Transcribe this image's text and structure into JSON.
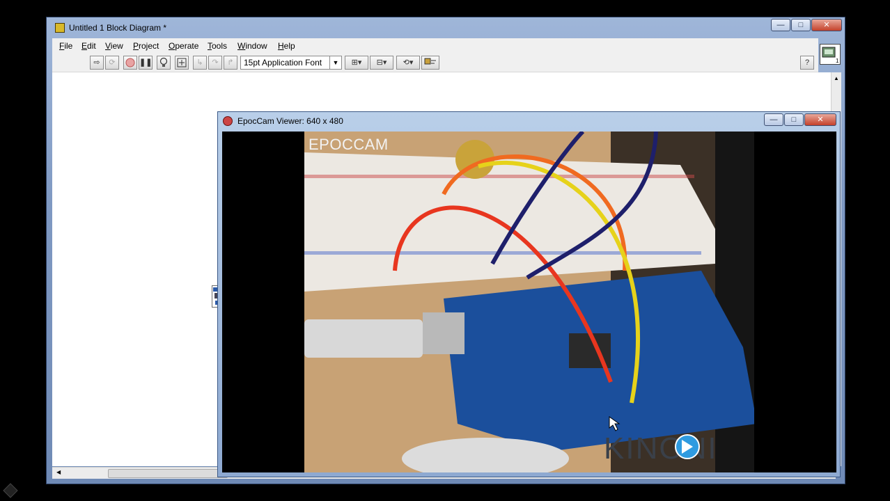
{
  "main_window": {
    "title": "Untitled 1 Block Diagram *",
    "controls": {
      "minimize": "—",
      "maximize": "□",
      "close": "✕"
    }
  },
  "menu": [
    {
      "ul": "F",
      "rest": "ile"
    },
    {
      "ul": "E",
      "rest": "dit"
    },
    {
      "ul": "V",
      "rest": "iew"
    },
    {
      "ul": "P",
      "rest": "roject"
    },
    {
      "ul": "O",
      "rest": "perate"
    },
    {
      "ul": "T",
      "rest": "ools"
    },
    {
      "ul": "W",
      "rest": "indow"
    },
    {
      "ul": "H",
      "rest": "elp"
    }
  ],
  "toolbar": {
    "font_select_value": "15pt Application Font",
    "help_label": "?"
  },
  "epoccam_window": {
    "title": "EpocCam Viewer: 640 x 480",
    "overlay_label": "EPOCCAM",
    "controls": {
      "minimize": "—",
      "maximize": "□",
      "close": "✕"
    }
  },
  "watermark": {
    "text": "KINONI"
  },
  "colors": {
    "wire_red": "#e8361f",
    "wire_orange": "#f06a20",
    "wire_yellow": "#e6d21a",
    "wire_navy": "#1e1f6b",
    "board_blue": "#1b4f9c",
    "table_wood": "#c8a275",
    "logo_accent": "#2f9be0"
  }
}
